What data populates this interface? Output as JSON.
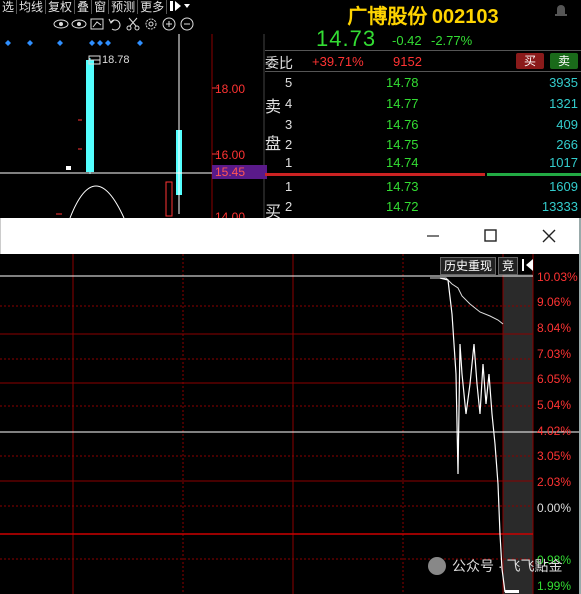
{
  "toolbar": {
    "items": [
      "选",
      "均线",
      "复权",
      "叠",
      "窗",
      "预测",
      "更多"
    ],
    "icons": [
      "eye-icon",
      "eye-icon",
      "undo-icon",
      "scissors-icon",
      "gear-icon",
      "zoom-in-icon",
      "zoom-out-icon"
    ]
  },
  "kline": {
    "max_label": "18.78",
    "axis_labels": [
      "18.00",
      "16.00",
      "14.00"
    ],
    "current_price_tag": "15.45",
    "colors": {
      "up": "#54ffff",
      "down": "#ff3333",
      "price_line": "#ffffff",
      "tag_bg": "#5a1a8a"
    }
  },
  "quote": {
    "name": "广博股份",
    "code": "002103",
    "price": "14.73",
    "change": "-0.42",
    "change_pct": "-2.77%",
    "weibi_label": "委比",
    "weibi_value": "+39.71%",
    "weicha_value": "9152",
    "buy_btn": "买",
    "sell_btn": "卖",
    "sell_side_label": [
      "卖",
      "盘"
    ],
    "buy_side_label": [
      "买"
    ],
    "asks": [
      {
        "level": "5",
        "price": "14.78",
        "vol": "3935"
      },
      {
        "level": "4",
        "price": "14.77",
        "vol": "1321"
      },
      {
        "level": "3",
        "price": "14.76",
        "vol": "409"
      },
      {
        "level": "2",
        "price": "14.75",
        "vol": "266"
      },
      {
        "level": "1",
        "price": "14.74",
        "vol": "1017"
      }
    ],
    "bids": [
      {
        "level": "1",
        "price": "14.73",
        "vol": "1609"
      },
      {
        "level": "2",
        "price": "14.72",
        "vol": "13333"
      }
    ]
  },
  "window": {
    "minimize_icon": "minimize-icon",
    "maximize_icon": "maximize-icon",
    "close_icon": "close-icon"
  },
  "intraday": {
    "buttons": [
      "历史重现",
      "竞"
    ],
    "pct_labels": [
      "10.03%",
      "9.06%",
      "8.04%",
      "7.03%",
      "6.05%",
      "5.04%",
      "4.02%",
      "3.05%",
      "2.03%",
      "0.00%",
      "0.98%",
      "1.99%"
    ],
    "colors": {
      "grid": "#8b0000",
      "line": "#ffffff",
      "auction_bg": "#2a2a2a"
    }
  },
  "watermark": {
    "label": "公众号 · 飞飞點金"
  }
}
